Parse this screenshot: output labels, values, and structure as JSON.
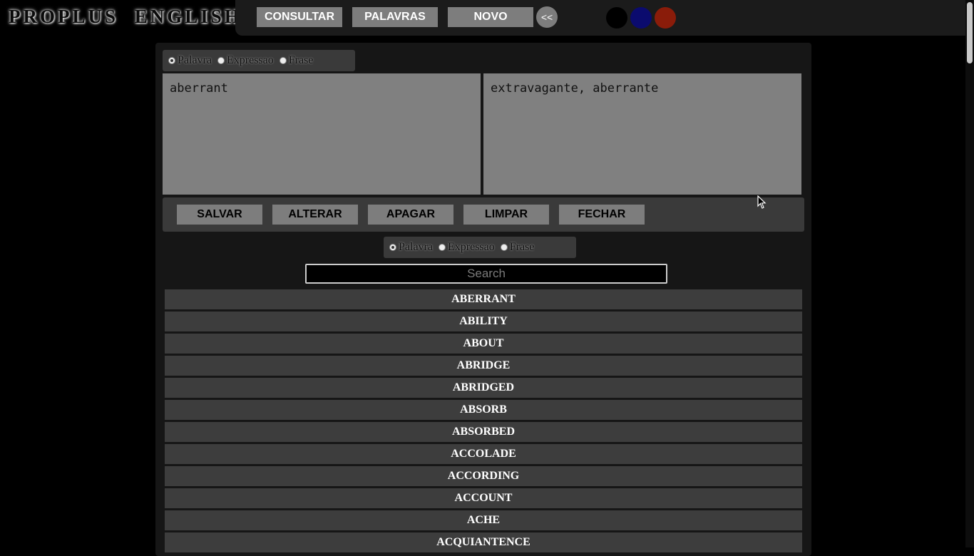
{
  "app": {
    "logo": "PROPLUS ENGLISH"
  },
  "topbar": {
    "buttons": [
      {
        "label": "CONSULTAR"
      },
      {
        "label": "PALAVRAS"
      },
      {
        "label": "NOVO"
      }
    ],
    "back_label": "<<",
    "themes": [
      {
        "name": "black",
        "color": "#000000"
      },
      {
        "name": "blue",
        "color": "#0b0b6e"
      },
      {
        "name": "red",
        "color": "#8a1c0a"
      }
    ]
  },
  "editor": {
    "type_options": [
      "Palavra",
      "Expressao",
      "Frase"
    ],
    "selected_type": "Palavra",
    "english_value": "aberrant",
    "portuguese_value": "extravagante, aberrante",
    "actions": [
      "SALVAR",
      "ALTERAR",
      "APAGAR",
      "LIMPAR",
      "FECHAR"
    ]
  },
  "filter": {
    "type_options": [
      "Palavra",
      "Expressao",
      "Frase"
    ],
    "selected_type": "Palavra",
    "search_placeholder": "Search"
  },
  "words": [
    "ABERRANT",
    "ABILITY",
    "ABOUT",
    "ABRIDGE",
    "ABRIDGED",
    "ABSORB",
    "ABSORBED",
    "ACCOLADE",
    "ACCORDING",
    "ACCOUNT",
    "ACHE",
    "ACQUIANTENCE"
  ]
}
